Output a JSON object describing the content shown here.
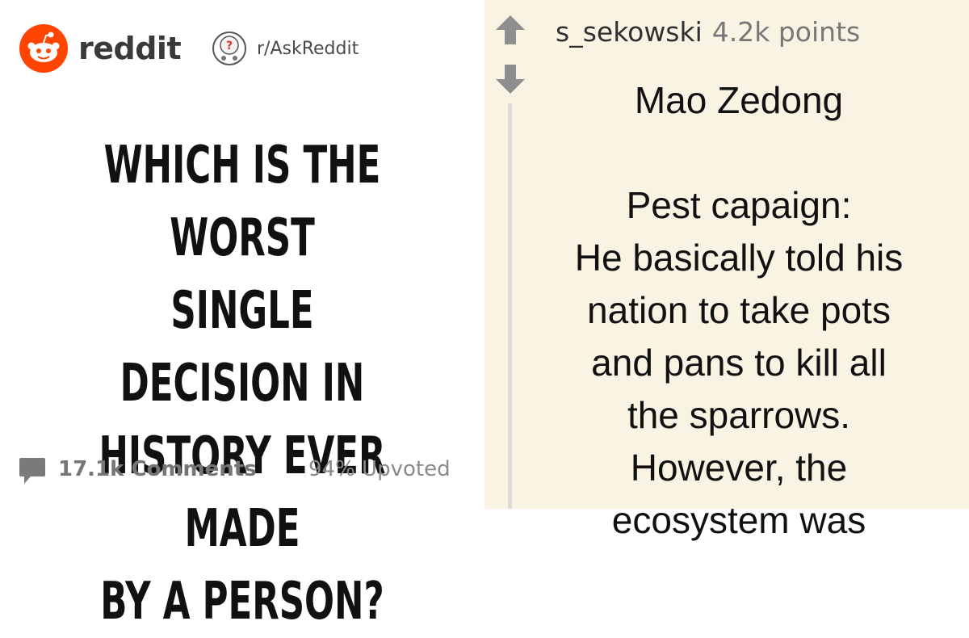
{
  "header": {
    "brand_name": "reddit",
    "subreddit": "r/AskReddit"
  },
  "post": {
    "title": "Which is the worst\nsingle decision in\nhistory ever made\nby a person?",
    "comments_count": "17.1k Comments",
    "upvoted": "94% Upvoted"
  },
  "comment": {
    "author": "s_sekowski",
    "points": "4.2k points",
    "heading": "Mao Zedong",
    "body": "Pest capaign:\nHe basically told his\nnation to take pots\nand pans to kill all\nthe sparrows.\nHowever, the\necosystem was"
  },
  "colors": {
    "reddit_orange": "#ff4500",
    "right_panel_bg": "#f8f3e2",
    "vote_arrow": "#8e8e8e"
  },
  "icons": {
    "brand": "reddit-snoo-icon",
    "subreddit": "askreddit-icon",
    "comments": "comment-bubble-icon",
    "upvote": "upvote-arrow-icon",
    "downvote": "downvote-arrow-icon"
  }
}
